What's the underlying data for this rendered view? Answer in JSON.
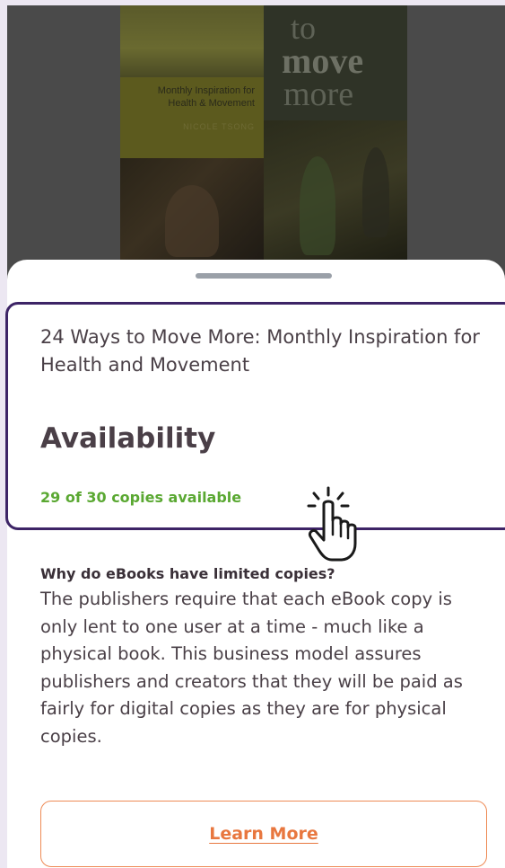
{
  "cover": {
    "title_line1": "to",
    "title_line2": "move",
    "title_line3": "more",
    "subtitle": "Monthly Inspiration for Health & Movement",
    "author": "NICOLE TSONG"
  },
  "sheet": {
    "book_title": "24 Ways to Move More: Monthly Inspiration for Health and Movement",
    "availability_heading": "Availability",
    "copies_available": "29 of 30 copies available",
    "why_heading": "Why do eBooks have limited copies?",
    "why_body": "The publishers require that each eBook copy is only lent to one user at a time - much like a physical book. This business model assures publishers and creators that they will be paid as fairly for digital copies as they are for physical copies.",
    "learn_more_label": "Learn More"
  },
  "colors": {
    "highlight_border": "#3d2466",
    "available_green": "#5aa832",
    "learn_more_orange": "#e8773f"
  },
  "icons": {
    "pointer": "hand-pointer-icon"
  }
}
